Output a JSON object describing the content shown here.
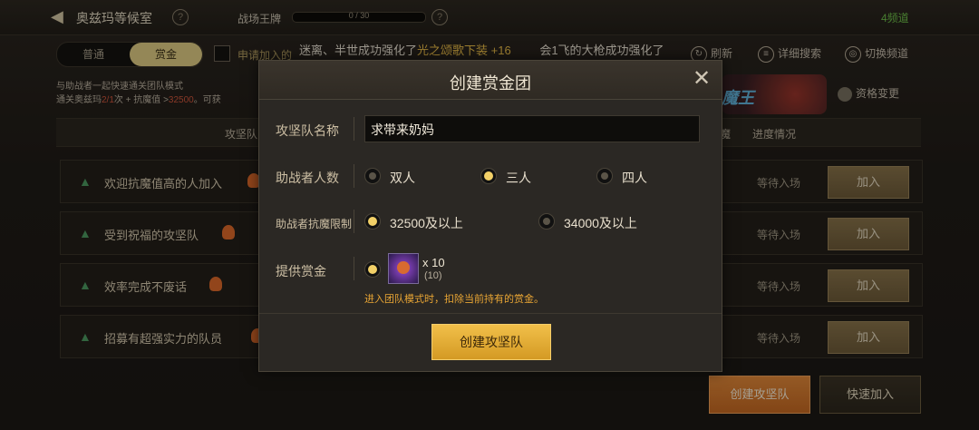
{
  "topbar": {
    "room_title": "奥兹玛等候室",
    "rank_label": "战场王牌",
    "rank_value": "0 / 30",
    "channel": "4频道"
  },
  "segment": {
    "tab1": "普通",
    "tab2": "赏金"
  },
  "filter": {
    "checkbox_label": "申请加入的"
  },
  "marquee": {
    "text1": "迷离、半世成功强化了",
    "highlight": "光之颂歌下装 +16",
    "text2": "会1飞的大枪成功强化了"
  },
  "tools": {
    "refresh": "刷新",
    "detail_search": "详细搜索",
    "switch_channel": "切换频道"
  },
  "description": {
    "line1": "与助战者一起快速通关团队模式",
    "line2_a": "通关奥兹玛",
    "line2_b": "2/1",
    "line2_c": "次 + 抗魔值 >",
    "line2_d": "32500",
    "line2_e": "。可获"
  },
  "banner_text": "魔王",
  "reset_label": "资格变更",
  "table_headers": {
    "h1": "攻坚队",
    "h2": "魔",
    "h3": "进度情况"
  },
  "rows": [
    {
      "name": "欢迎抗魔值高的人加入",
      "status": "等待入场",
      "join": "加入"
    },
    {
      "name": "受到祝福的攻坚队",
      "status": "等待入场",
      "join": "加入"
    },
    {
      "name": "效率完成不废话",
      "status": "等待入场",
      "join": "加入"
    },
    {
      "name": "招募有超强实力的队员",
      "status": "等待入场",
      "join": "加入"
    }
  ],
  "bottom": {
    "create": "创建攻坚队",
    "quick_join": "快速加入"
  },
  "modal": {
    "title": "创建赏金团",
    "name_label": "攻坚队名称",
    "name_value": "求带来奶妈",
    "count_label": "助战者人数",
    "count_options": [
      "双人",
      "三人",
      "四人"
    ],
    "count_selected": "三人",
    "limit_label": "助战者抗魔限制",
    "limit_options": [
      "32500及以上",
      "34000及以上"
    ],
    "limit_selected": "32500及以上",
    "reward_label": "提供赏金",
    "reward_count": "x 10",
    "reward_sub": "(10)",
    "warning": "进入团队模式时，扣除当前持有的赏金。",
    "submit": "创建攻坚队"
  },
  "colors": {
    "accent_gold": "#f2d067",
    "create_orange": "#e48a3a",
    "warning": "#e8a534",
    "channel_green": "#6fc24a"
  },
  "icons": [
    "back-arrow-icon",
    "help-icon",
    "refresh-icon",
    "search-filter-icon",
    "globe-icon",
    "close-icon",
    "arrow-up-icon",
    "flame-icon",
    "reward-item-icon"
  ]
}
